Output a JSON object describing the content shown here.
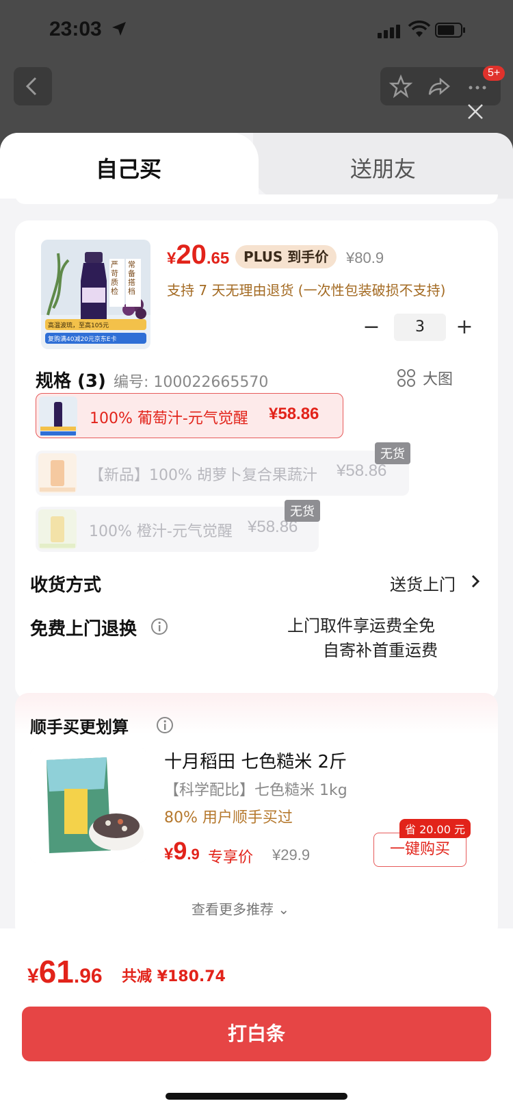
{
  "status": {
    "time": "23:03"
  },
  "nav": {
    "badge": "5+"
  },
  "tabs": [
    {
      "label": "自己买"
    },
    {
      "label": "送朋友"
    }
  ],
  "product": {
    "price_currency": "¥",
    "price_int": "20",
    "price_dec": ".65",
    "plus_tag": "PLUS 到手价",
    "original_price": "¥80.9",
    "return_note": "支持 7 天无理由退货 (一次性包装破损不支持)",
    "quantity": "3",
    "thumb_lines": [
      "严",
      "苛",
      "质",
      "检",
      "常",
      "备",
      "搭",
      "档"
    ],
    "thumb_banner1": "高温波琉，至高105元",
    "thumb_banner2": "复购满40减20元京东E卡"
  },
  "spec": {
    "title": "规格 (3)",
    "code": "编号: 100022665570",
    "big_image_label": "大图",
    "options": [
      {
        "name": "100% 葡萄汁-元气觉醒",
        "price": "¥58.86"
      },
      {
        "name": "【新品】100% 胡萝卜复合果蔬汁",
        "price": "¥58.86",
        "status": "无货"
      },
      {
        "name": "100% 橙汁-元气觉醒",
        "price": "¥58.86",
        "status": "无货"
      }
    ]
  },
  "delivery": {
    "label": "收货方式",
    "value": "送货上门"
  },
  "return_service": {
    "label": "免费上门退换",
    "line1": "上门取件享运费全免",
    "line2": "自寄补首重运费"
  },
  "recommend": {
    "title": "顺手买更划算",
    "name": "十月稻田 七色糙米 2斤",
    "subtitle": "【科学配比】七色糙米 1kg",
    "buyers": "80% 用户顺手买过",
    "price_currency": "¥",
    "price_int": "9",
    "price_dec": ".9",
    "exclusive": "专享价",
    "original_price": "¥29.9",
    "save_tag": "省 20.00 元",
    "buy_button": "一键购买",
    "see_more": "查看更多推荐"
  },
  "footer": {
    "total_currency": "¥",
    "total_int": "61",
    "total_dec": ".96",
    "saved": "共减 ¥180.74",
    "pay_button": "打白条"
  },
  "colors": {
    "accent": "#e2231a",
    "pay": "#e64545",
    "plus_tag_bg": "#f6e2cf"
  }
}
